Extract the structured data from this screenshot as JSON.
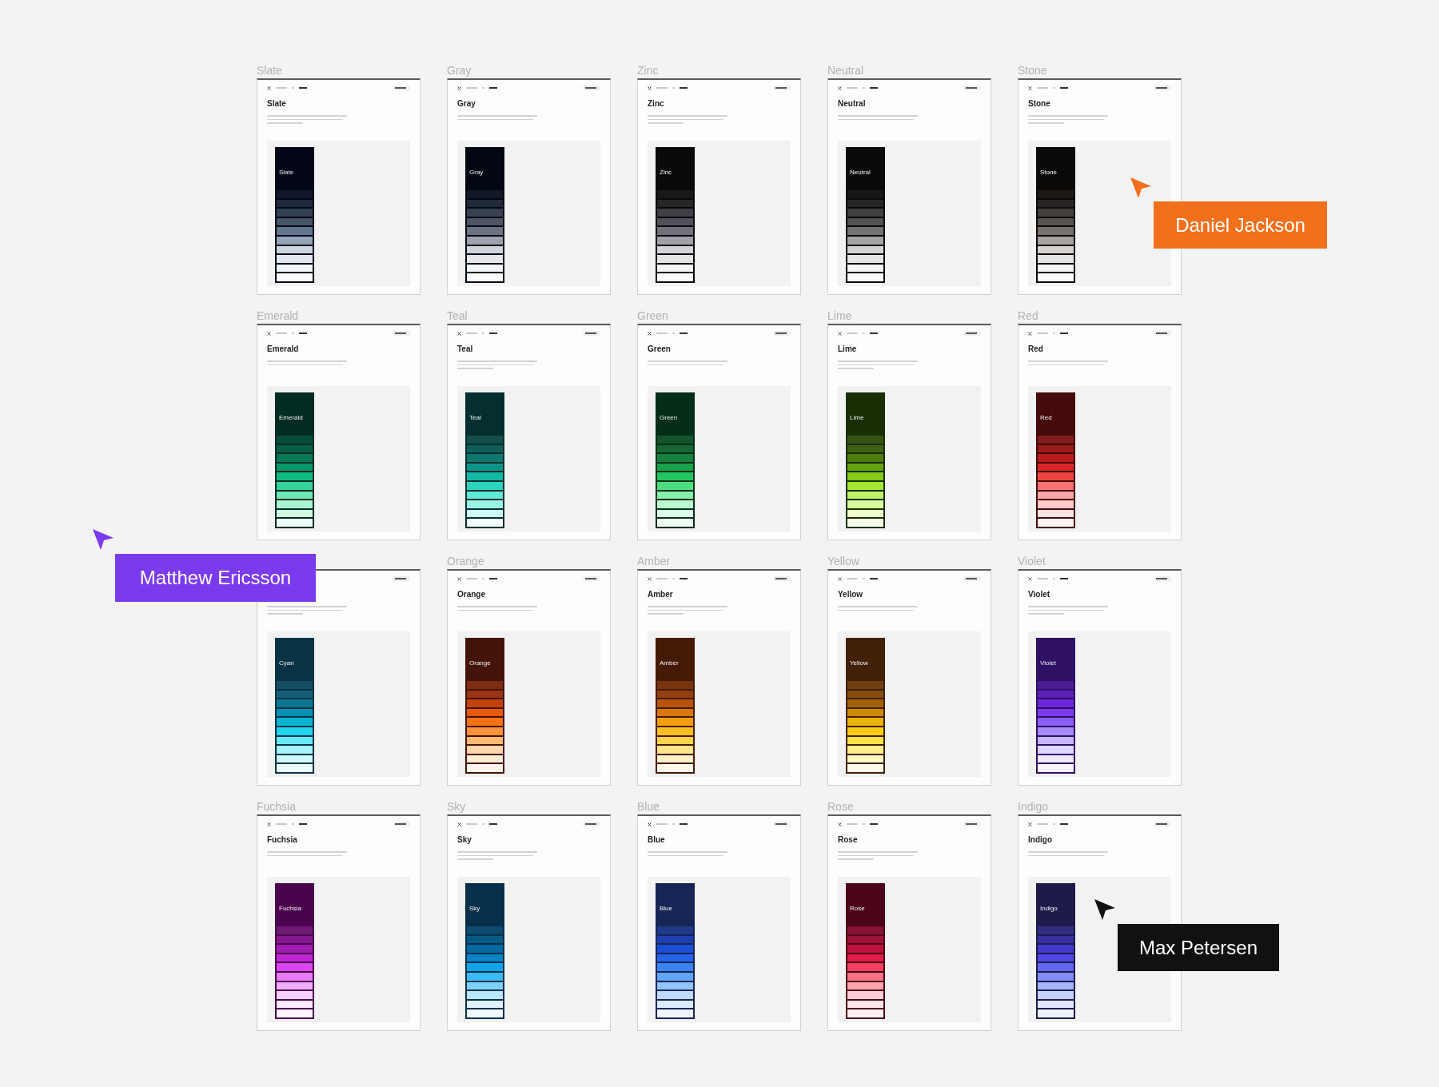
{
  "canvas": {
    "frames": [
      {
        "label": "Slate",
        "title": "Slate",
        "swatch_title": "Slate",
        "shades": [
          {
            "color": "#020617"
          },
          {
            "color": "#0f172a"
          },
          {
            "color": "#1e293b"
          },
          {
            "color": "#334155"
          },
          {
            "color": "#475569"
          },
          {
            "color": "#64748b"
          },
          {
            "color": "#94a3b8"
          },
          {
            "color": "#cbd5e1"
          },
          {
            "color": "#e2e8f0"
          },
          {
            "color": "#f1f5f9"
          },
          {
            "color": "#f8fafc"
          }
        ]
      },
      {
        "label": "Gray",
        "title": "Gray",
        "swatch_title": "Gray",
        "shades": [
          {
            "color": "#030712"
          },
          {
            "color": "#111827"
          },
          {
            "color": "#1f2937"
          },
          {
            "color": "#374151"
          },
          {
            "color": "#4b5563"
          },
          {
            "color": "#6b7280"
          },
          {
            "color": "#9ca3af"
          },
          {
            "color": "#d1d5db"
          },
          {
            "color": "#e5e7eb"
          },
          {
            "color": "#f3f4f6"
          },
          {
            "color": "#f9fafb"
          }
        ]
      },
      {
        "label": "Zinc",
        "title": "Zinc",
        "swatch_title": "Zinc",
        "shades": [
          {
            "color": "#09090b"
          },
          {
            "color": "#18181b"
          },
          {
            "color": "#27272a"
          },
          {
            "color": "#3f3f46"
          },
          {
            "color": "#52525b"
          },
          {
            "color": "#71717a"
          },
          {
            "color": "#a1a1aa"
          },
          {
            "color": "#d4d4d8"
          },
          {
            "color": "#e4e4e7"
          },
          {
            "color": "#f4f4f5"
          },
          {
            "color": "#fafafa"
          }
        ]
      },
      {
        "label": "Neutral",
        "title": "Neutral",
        "swatch_title": "Neutral",
        "shades": [
          {
            "color": "#0a0a0a"
          },
          {
            "color": "#171717"
          },
          {
            "color": "#262626"
          },
          {
            "color": "#404040"
          },
          {
            "color": "#525252"
          },
          {
            "color": "#737373"
          },
          {
            "color": "#a3a3a3"
          },
          {
            "color": "#d4d4d4"
          },
          {
            "color": "#e5e5e5"
          },
          {
            "color": "#f5f5f5"
          },
          {
            "color": "#fafafa"
          }
        ]
      },
      {
        "label": "Stone",
        "title": "Stone",
        "swatch_title": "Stone",
        "shades": [
          {
            "color": "#0c0a09"
          },
          {
            "color": "#1c1917"
          },
          {
            "color": "#292524"
          },
          {
            "color": "#44403c"
          },
          {
            "color": "#57534e"
          },
          {
            "color": "#78716c"
          },
          {
            "color": "#a8a29e"
          },
          {
            "color": "#d6d3d1"
          },
          {
            "color": "#e7e5e4"
          },
          {
            "color": "#f5f5f4"
          },
          {
            "color": "#fafaf9"
          }
        ]
      },
      {
        "label": "Emerald",
        "title": "Emerald",
        "swatch_title": "Emerald",
        "shades": [
          {
            "color": "#022c22"
          },
          {
            "color": "#064e3b"
          },
          {
            "color": "#065f46"
          },
          {
            "color": "#047857"
          },
          {
            "color": "#059669"
          },
          {
            "color": "#10b981"
          },
          {
            "color": "#34d399"
          },
          {
            "color": "#6ee7b7"
          },
          {
            "color": "#a7f3d0"
          },
          {
            "color": "#d1fae5"
          },
          {
            "color": "#ecfdf5"
          }
        ]
      },
      {
        "label": "Teal",
        "title": "Teal",
        "swatch_title": "Teal",
        "shades": [
          {
            "color": "#042f2e"
          },
          {
            "color": "#134e4a"
          },
          {
            "color": "#115e59"
          },
          {
            "color": "#0f766e"
          },
          {
            "color": "#0d9488"
          },
          {
            "color": "#14b8a6"
          },
          {
            "color": "#2dd4bf"
          },
          {
            "color": "#5eead4"
          },
          {
            "color": "#99f6e4"
          },
          {
            "color": "#ccfbf1"
          },
          {
            "color": "#f0fdfa"
          }
        ]
      },
      {
        "label": "Green",
        "title": "Green",
        "swatch_title": "Green",
        "shades": [
          {
            "color": "#052e16"
          },
          {
            "color": "#14532d"
          },
          {
            "color": "#166534"
          },
          {
            "color": "#15803d"
          },
          {
            "color": "#16a34a"
          },
          {
            "color": "#22c55e"
          },
          {
            "color": "#4ade80"
          },
          {
            "color": "#86efac"
          },
          {
            "color": "#bbf7d0"
          },
          {
            "color": "#dcfce7"
          },
          {
            "color": "#f0fdf4"
          }
        ]
      },
      {
        "label": "Lime",
        "title": "Lime",
        "swatch_title": "Lime",
        "shades": [
          {
            "color": "#1a2e05"
          },
          {
            "color": "#365314"
          },
          {
            "color": "#3f6212"
          },
          {
            "color": "#4d7c0f"
          },
          {
            "color": "#65a30d"
          },
          {
            "color": "#84cc16"
          },
          {
            "color": "#a3e635"
          },
          {
            "color": "#bef264"
          },
          {
            "color": "#d9f99d"
          },
          {
            "color": "#ecfccb"
          },
          {
            "color": "#f7fee7"
          }
        ]
      },
      {
        "label": "Red",
        "title": "Red",
        "swatch_title": "Red",
        "shades": [
          {
            "color": "#450a0a"
          },
          {
            "color": "#7f1d1d"
          },
          {
            "color": "#991b1b"
          },
          {
            "color": "#b91c1c"
          },
          {
            "color": "#dc2626"
          },
          {
            "color": "#ef4444"
          },
          {
            "color": "#f87171"
          },
          {
            "color": "#fca5a5"
          },
          {
            "color": "#fecaca"
          },
          {
            "color": "#fee2e2"
          },
          {
            "color": "#fef2f2"
          }
        ]
      },
      {
        "swatch_title": "Cyan",
        "shades": [
          {
            "color": "#083344"
          },
          {
            "color": "#164e63"
          },
          {
            "color": "#155e75"
          },
          {
            "color": "#0e7490"
          },
          {
            "color": "#0891b2"
          },
          {
            "color": "#06b6d4"
          },
          {
            "color": "#22d3ee"
          },
          {
            "color": "#67e8f9"
          },
          {
            "color": "#a5f3fc"
          },
          {
            "color": "#cffafe"
          },
          {
            "color": "#ecfeff"
          }
        ]
      },
      {
        "label": "Orange",
        "title": "Orange",
        "swatch_title": "Orange",
        "shades": [
          {
            "color": "#431407"
          },
          {
            "color": "#7c2d12"
          },
          {
            "color": "#9a3412"
          },
          {
            "color": "#c2410c"
          },
          {
            "color": "#ea580c"
          },
          {
            "color": "#f97316"
          },
          {
            "color": "#fb923c"
          },
          {
            "color": "#fdba74"
          },
          {
            "color": "#fed7aa"
          },
          {
            "color": "#ffedd5"
          },
          {
            "color": "#fff7ed"
          }
        ]
      },
      {
        "label": "Amber",
        "title": "Amber",
        "swatch_title": "Amber",
        "shades": [
          {
            "color": "#451a03"
          },
          {
            "color": "#78350f"
          },
          {
            "color": "#92400e"
          },
          {
            "color": "#b45309"
          },
          {
            "color": "#d97706"
          },
          {
            "color": "#f59e0b"
          },
          {
            "color": "#fbbf24"
          },
          {
            "color": "#fcd34d"
          },
          {
            "color": "#fde68a"
          },
          {
            "color": "#fef3c7"
          },
          {
            "color": "#fffbeb"
          }
        ]
      },
      {
        "label": "Yellow",
        "title": "Yellow",
        "swatch_title": "Yellow",
        "shades": [
          {
            "color": "#422006"
          },
          {
            "color": "#713f12"
          },
          {
            "color": "#854d0e"
          },
          {
            "color": "#a16207"
          },
          {
            "color": "#ca8a04"
          },
          {
            "color": "#eab308"
          },
          {
            "color": "#facc15"
          },
          {
            "color": "#fde047"
          },
          {
            "color": "#fef08a"
          },
          {
            "color": "#fef9c3"
          },
          {
            "color": "#fefce8"
          }
        ]
      },
      {
        "label": "Violet",
        "title": "Violet",
        "swatch_title": "Violet",
        "shades": [
          {
            "color": "#2e1065"
          },
          {
            "color": "#4c1d95"
          },
          {
            "color": "#5b21b6"
          },
          {
            "color": "#6d28d9"
          },
          {
            "color": "#7c3aed"
          },
          {
            "color": "#8b5cf6"
          },
          {
            "color": "#a78bfa"
          },
          {
            "color": "#c4b5fd"
          },
          {
            "color": "#ddd6fe"
          },
          {
            "color": "#ede9fe"
          },
          {
            "color": "#f5f3ff"
          }
        ]
      },
      {
        "label": "Fuchsia",
        "title": "Fuchsia",
        "swatch_title": "Fuchsia",
        "shades": [
          {
            "color": "#4a044e"
          },
          {
            "color": "#701a75"
          },
          {
            "color": "#86198f"
          },
          {
            "color": "#a21caf"
          },
          {
            "color": "#c026d3"
          },
          {
            "color": "#d946ef"
          },
          {
            "color": "#e879f9"
          },
          {
            "color": "#f0abfc"
          },
          {
            "color": "#f5d0fe"
          },
          {
            "color": "#fae8ff"
          },
          {
            "color": "#fdf4ff"
          }
        ]
      },
      {
        "label": "Sky",
        "title": "Sky",
        "swatch_title": "Sky",
        "shades": [
          {
            "color": "#082f49"
          },
          {
            "color": "#0c4a6e"
          },
          {
            "color": "#075985"
          },
          {
            "color": "#0369a1"
          },
          {
            "color": "#0284c7"
          },
          {
            "color": "#0ea5e9"
          },
          {
            "color": "#38bdf8"
          },
          {
            "color": "#7dd3fc"
          },
          {
            "color": "#bae6fd"
          },
          {
            "color": "#e0f2fe"
          },
          {
            "color": "#f0f9ff"
          }
        ]
      },
      {
        "label": "Blue",
        "title": "Blue",
        "swatch_title": "Blue",
        "shades": [
          {
            "color": "#172554"
          },
          {
            "color": "#1e3a8a"
          },
          {
            "color": "#1e40af"
          },
          {
            "color": "#1d4ed8"
          },
          {
            "color": "#2563eb"
          },
          {
            "color": "#3b82f6"
          },
          {
            "color": "#60a5fa"
          },
          {
            "color": "#93c5fd"
          },
          {
            "color": "#bfdbfe"
          },
          {
            "color": "#dbeafe"
          },
          {
            "color": "#eff6ff"
          }
        ]
      },
      {
        "label": "Rose",
        "title": "Rose",
        "swatch_title": "Rose",
        "shades": [
          {
            "color": "#4c0519"
          },
          {
            "color": "#881337"
          },
          {
            "color": "#9f1239"
          },
          {
            "color": "#be123c"
          },
          {
            "color": "#e11d48"
          },
          {
            "color": "#f43f5e"
          },
          {
            "color": "#fb7185"
          },
          {
            "color": "#fda4af"
          },
          {
            "color": "#fecdd3"
          },
          {
            "color": "#ffe4e6"
          },
          {
            "color": "#fff1f2"
          }
        ]
      },
      {
        "label": "Indigo",
        "title": "Indigo",
        "swatch_title": "Indigo",
        "shades": [
          {
            "color": "#1e1b4b"
          },
          {
            "color": "#312e81"
          },
          {
            "color": "#3730a3"
          },
          {
            "color": "#4338ca"
          },
          {
            "color": "#4f46e5"
          },
          {
            "color": "#6366f1"
          },
          {
            "color": "#818cf8"
          },
          {
            "color": "#a5b4fc"
          },
          {
            "color": "#c7d2fe"
          },
          {
            "color": "#e0e7ff"
          },
          {
            "color": "#eef2ff"
          }
        ]
      }
    ]
  },
  "cursors": [
    {
      "name": "Daniel Jackson",
      "color": "#f2701c"
    },
    {
      "name": "Matthew Ericsson",
      "color": "#7c3aed"
    },
    {
      "name": "Max Petersen",
      "color": "#111111"
    }
  ]
}
